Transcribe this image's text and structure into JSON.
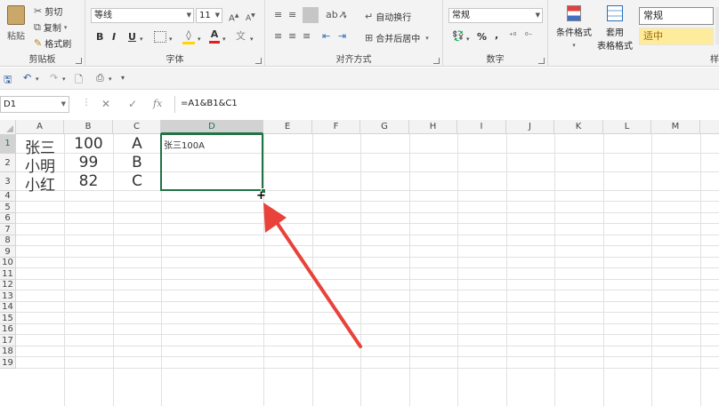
{
  "ribbon": {
    "clipboard": {
      "paste": "粘贴",
      "cut": "剪切",
      "copy": "复制",
      "format_painter": "格式刷",
      "title": "剪贴板"
    },
    "font": {
      "font_name": "等线",
      "font_size": "11",
      "bold": "B",
      "italic": "I",
      "underline": "U",
      "title": "字体"
    },
    "alignment": {
      "wrap_text": "自动换行",
      "merge_center": "合并后居中",
      "title": "对齐方式"
    },
    "number": {
      "format": "常规",
      "percent": "%",
      "comma": ",",
      "title": "数字"
    },
    "styles": {
      "conditional_format": "条件格式",
      "table_format_1": "套用",
      "table_format_2": "表格格式",
      "style_normal": "常规",
      "style_neutral": "适中",
      "title_partial": "样"
    }
  },
  "formula_bar": {
    "name_box": "D1",
    "fx": "fx",
    "formula": "=A1&B1&C1"
  },
  "columns": [
    "A",
    "B",
    "C",
    "D",
    "E",
    "F",
    "G",
    "H",
    "I",
    "J",
    "K",
    "L",
    "M"
  ],
  "rows": [
    "1",
    "2",
    "3",
    "4",
    "5",
    "6",
    "7",
    "8",
    "9",
    "10",
    "11",
    "12",
    "13",
    "14",
    "15",
    "16",
    "17",
    "18",
    "19"
  ],
  "cells": {
    "a1": "张三",
    "b1": "100",
    "c1": "A",
    "a2": "小明",
    "b2": "99",
    "c2": "B",
    "a3": "小红",
    "b3": "82",
    "c3": "C",
    "d1": "张三100A"
  },
  "colors": {
    "accent": "#217346",
    "arrow": "#e8423a",
    "neutral_style_bg": "#ffeb9c"
  }
}
